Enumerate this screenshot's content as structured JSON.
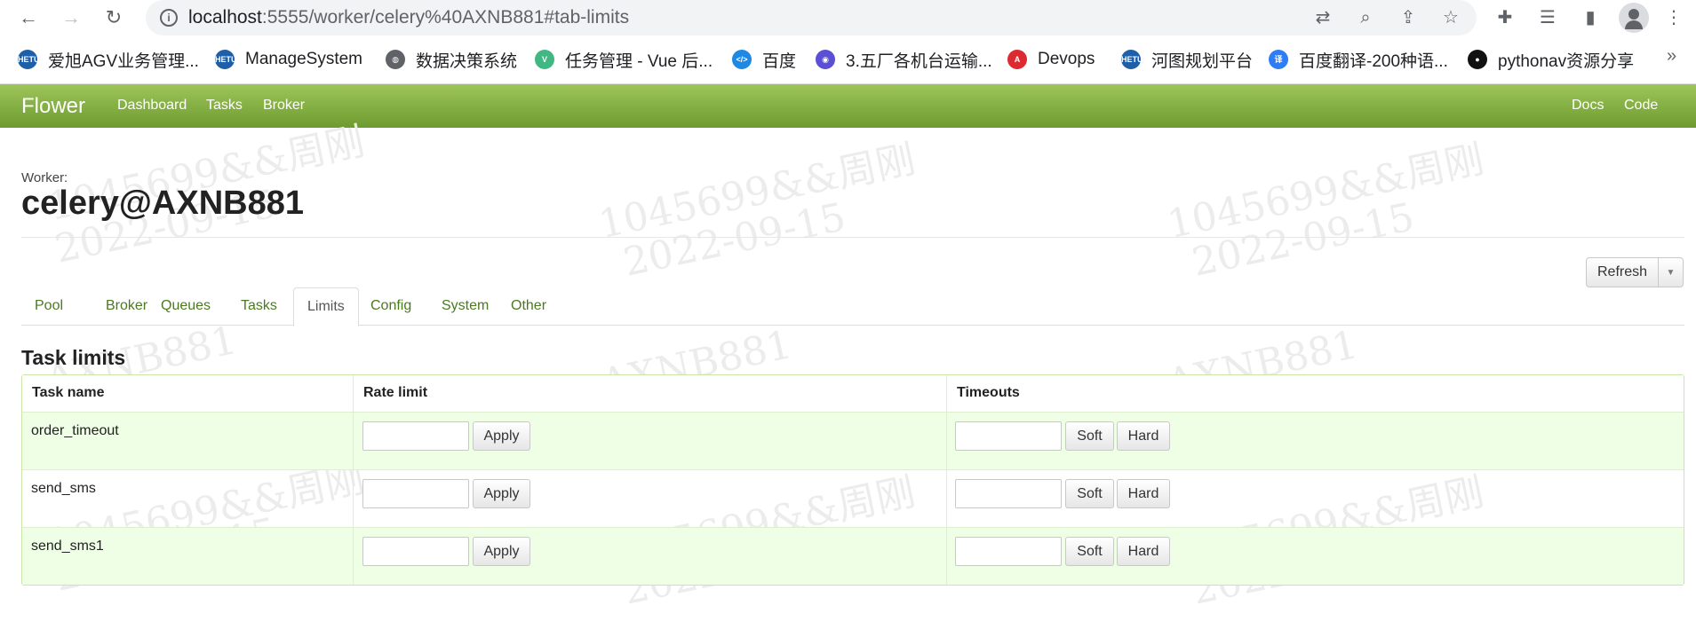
{
  "browser": {
    "url_host": "localhost",
    "url_rest": ":5555/worker/celery%40AXNB881#tab-limits",
    "bookmarks": [
      {
        "label": "爱旭AGV业务管理...",
        "icon": "hetu-icon",
        "color": "#1f5fa8"
      },
      {
        "label": "ManageSystem",
        "icon": "hetu-icon",
        "color": "#1f5fa8"
      },
      {
        "label": "数据决策系统",
        "icon": "globe-icon",
        "color": "#5f6368"
      },
      {
        "label": "任务管理 - Vue 后...",
        "icon": "vue-icon",
        "color": "#41b883"
      },
      {
        "label": "百度",
        "icon": "code-icon",
        "color": "#1e88e5"
      },
      {
        "label": "3.五厂各机台运输...",
        "icon": "bulb-icon",
        "color": "#5b4fd6"
      },
      {
        "label": "Devops",
        "icon": "angular-icon",
        "color": "#dd2a30"
      },
      {
        "label": "河图规划平台",
        "icon": "hetu-icon",
        "color": "#1f5fa8"
      },
      {
        "label": "百度翻译-200种语...",
        "icon": "translate-icon",
        "color": "#2f7df6"
      },
      {
        "label": "pythonav资源分享",
        "icon": "person-icon",
        "color": "#111111"
      }
    ],
    "more": "»"
  },
  "navbar": {
    "brand": "Flower",
    "links": [
      "Dashboard",
      "Tasks",
      "Broker"
    ],
    "right_links": [
      "Docs",
      "Code"
    ]
  },
  "watermark": {
    "line1": "1045699&&周刚",
    "line2": "2022-09-15",
    "line3": "AXNB881"
  },
  "worker": {
    "label": "Worker:",
    "name": "celery@AXNB881"
  },
  "refresh": {
    "label": "Refresh",
    "caret": "▼"
  },
  "tabs": [
    {
      "label": "Pool",
      "active": false
    },
    {
      "label": "Broker",
      "active": false
    },
    {
      "label": "Queues",
      "active": false
    },
    {
      "label": "Tasks",
      "active": false
    },
    {
      "label": "Limits",
      "active": true
    },
    {
      "label": "Config",
      "active": false
    },
    {
      "label": "System",
      "active": false
    },
    {
      "label": "Other",
      "active": false
    }
  ],
  "limits": {
    "title": "Task limits",
    "columns": [
      "Task name",
      "Rate limit",
      "Timeouts"
    ],
    "apply_label": "Apply",
    "soft_label": "Soft",
    "hard_label": "Hard",
    "rows": [
      {
        "task": "order_timeout",
        "rate_limit": "",
        "timeout": ""
      },
      {
        "task": "send_sms",
        "rate_limit": "",
        "timeout": ""
      },
      {
        "task": "send_sms1",
        "rate_limit": "",
        "timeout": ""
      }
    ]
  }
}
